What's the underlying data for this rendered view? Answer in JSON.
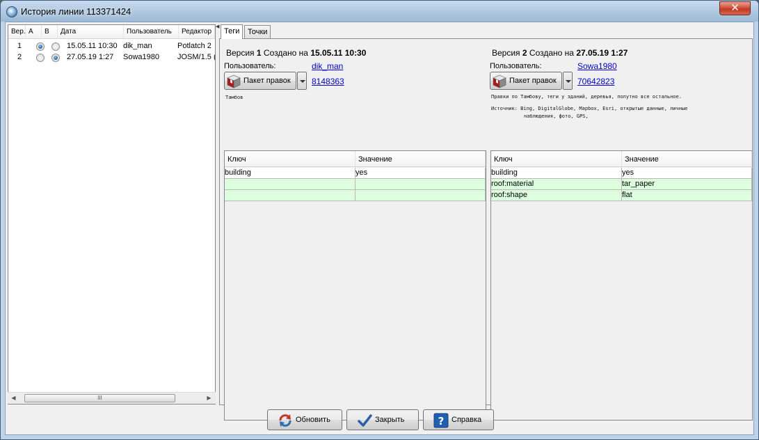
{
  "window": {
    "title": "История линии 113371424",
    "close_glyph": "✕"
  },
  "history": {
    "columns": [
      "Вер.",
      "A",
      "B",
      "Дата",
      "Пользователь",
      "Редактор"
    ],
    "rows": [
      {
        "ver": "1",
        "a": true,
        "b": false,
        "date": "15.05.11 10:30",
        "user": "dik_man",
        "editor": "Potlatch 2"
      },
      {
        "ver": "2",
        "a": false,
        "b": true,
        "date": "27.05.19 1:27",
        "user": "Sowa1980",
        "editor": "JOSM/1.5 ("
      }
    ],
    "scroll_thumb": "III"
  },
  "tabs": [
    {
      "label": "Теги",
      "active": true
    },
    {
      "label": "Точки",
      "active": false
    }
  ],
  "left_version": {
    "prefix": "Версия ",
    "num": "1",
    "mid": " Создано на ",
    "date": "15.05.11 10:30",
    "user_label": "Пользователь:",
    "user": "dik_man",
    "changeset_label": "Пакет правок",
    "changeset": "8148363",
    "comment": "Тамбов",
    "table_headers": [
      "Ключ",
      "Значение"
    ],
    "tags": [
      {
        "key": "building",
        "value": "yes",
        "diff": false
      },
      {
        "key": "",
        "value": "",
        "diff": true
      },
      {
        "key": "",
        "value": "",
        "diff": true
      }
    ]
  },
  "right_version": {
    "prefix": "Версия ",
    "num": "2",
    "mid": " Создано на ",
    "date": "27.05.19 1:27",
    "user_label": "Пользователь:",
    "user": "Sowa1980",
    "changeset_label": "Пакет правок",
    "changeset": "70642823",
    "comment": "Правки по Тамбову, теги у зданий, деревья, попутно все остальное.",
    "source_line1": "Источник: Bing, DigitalGlobe, Mapbox, Esri, открытые данные, личные",
    "source_line2": "наблюдения, фото, GPS,",
    "table_headers": [
      "Ключ",
      "Значение"
    ],
    "tags": [
      {
        "key": "building",
        "value": "yes",
        "diff": false
      },
      {
        "key": "roof:material",
        "value": "tar_paper",
        "diff": true
      },
      {
        "key": "roof:shape",
        "value": "flat",
        "diff": true
      }
    ]
  },
  "buttons": {
    "refresh": "Обновить",
    "close": "Закрыть",
    "help": "Справка"
  },
  "colors": {
    "diff_row": "#ddffdd",
    "link": "#0000cc",
    "selection": "#1d5fa0"
  },
  "icons": {
    "title": "history-icon",
    "changeset": "changeset-cube-icon",
    "dropdown": "chevron-down-icon",
    "refresh": "refresh-icon",
    "close": "checkmark-icon",
    "help": "question-icon"
  }
}
